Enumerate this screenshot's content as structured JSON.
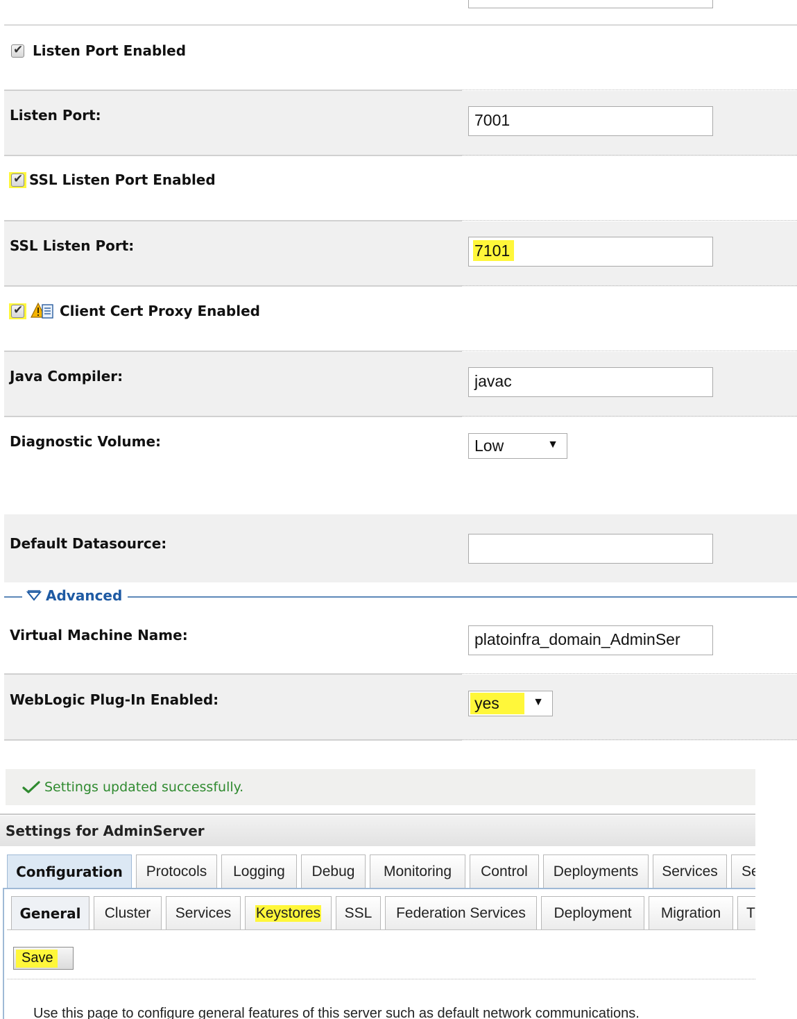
{
  "form": {
    "listen_port_enabled": {
      "label": "Listen Port Enabled",
      "checked": true
    },
    "listen_port": {
      "label": "Listen Port:",
      "value": "7001"
    },
    "ssl_listen_port_enabled": {
      "label": "SSL Listen Port Enabled",
      "checked": true
    },
    "ssl_listen_port": {
      "label": "SSL Listen Port:",
      "value": "7101"
    },
    "client_cert_proxy_enabled": {
      "label": "Client Cert Proxy Enabled",
      "checked": true
    },
    "java_compiler": {
      "label": "Java Compiler:",
      "value": "javac"
    },
    "diagnostic_volume": {
      "label": "Diagnostic Volume:",
      "value": "Low"
    },
    "default_datasource": {
      "label": "Default Datasource:",
      "value": ""
    }
  },
  "advanced": {
    "title": "Advanced",
    "virtual_machine_name": {
      "label": "Virtual Machine Name:",
      "value": "platoinfra_domain_AdminSer"
    },
    "weblogic_plugin_enabled": {
      "label": "WebLogic Plug-In Enabled:",
      "value": "yes"
    }
  },
  "status": {
    "message": "Settings updated successfully."
  },
  "settings": {
    "title": "Settings for AdminServer",
    "primary_tabs": [
      "Configuration",
      "Protocols",
      "Logging",
      "Debug",
      "Monitoring",
      "Control",
      "Deployments",
      "Services",
      "Se"
    ],
    "secondary_tabs": [
      "General",
      "Cluster",
      "Services",
      "Keystores",
      "SSL",
      "Federation Services",
      "Deployment",
      "Migration",
      "T"
    ],
    "save_label": "Save",
    "description": "Use this page to configure general features of this server such as default network communications."
  },
  "colors": {
    "highlight": "#fff73a",
    "link": "#1e5aa3",
    "success": "#2f8a2f"
  }
}
